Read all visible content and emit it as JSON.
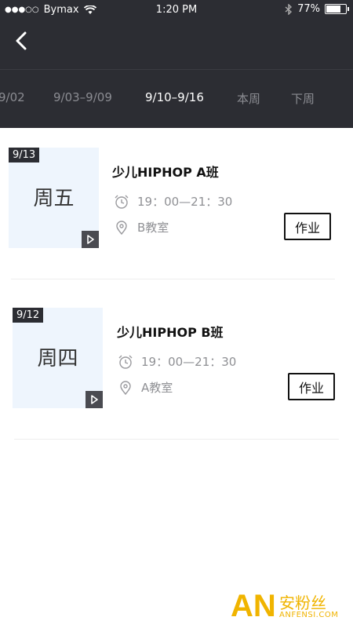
{
  "status_bar": {
    "carrier": "Bymax",
    "time": "1:20 PM",
    "battery": "77%",
    "battery_level": 0.77
  },
  "week_tabs": [
    {
      "label": "9/02"
    },
    {
      "label": "9/03–9/09"
    },
    {
      "label": "9/10–9/16"
    },
    {
      "label": "本周"
    },
    {
      "label": "下周"
    }
  ],
  "courses": [
    {
      "date": "9/13",
      "weekday": "周五",
      "title": "少儿HIPHOP A班",
      "time": "19：00—21：30",
      "room": "B教室",
      "button": "作业"
    },
    {
      "date": "9/12",
      "weekday": "周四",
      "title": "少儿HIPHOP B班",
      "time": "19：00—21：30",
      "room": "A教室",
      "button": "作业"
    }
  ],
  "watermark": {
    "logo": "AN",
    "cn": "安粉丝",
    "en": "ANFENSI.COM"
  }
}
